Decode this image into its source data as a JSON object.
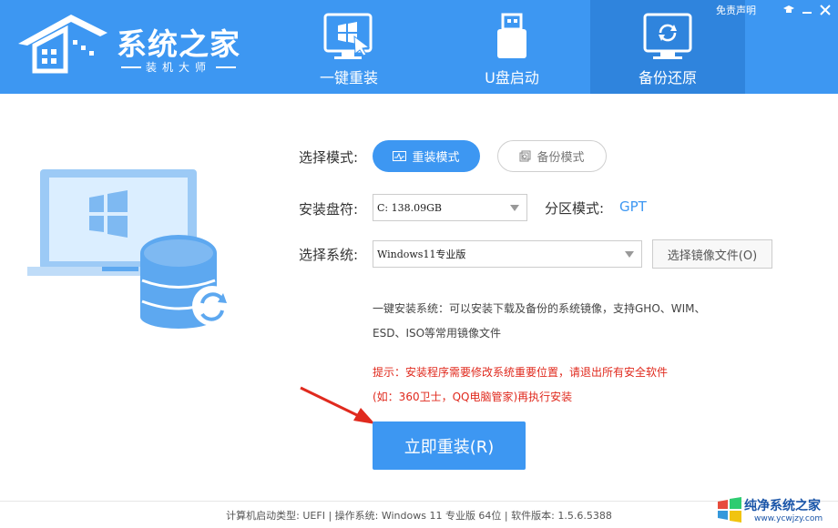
{
  "header": {
    "logo": {
      "title": "系统之家",
      "subtitle": "装机大师"
    },
    "top_links": {
      "disclaimer": "免责声明"
    },
    "tabs": [
      {
        "label": "一键重装",
        "icon": "windows-cursor-icon",
        "active": false
      },
      {
        "label": "U盘启动",
        "icon": "usb-drive-icon",
        "active": false
      },
      {
        "label": "备份还原",
        "icon": "backup-restore-icon",
        "active": true
      }
    ]
  },
  "form": {
    "mode_label": "选择模式:",
    "mode_options": {
      "reinstall": "重装模式",
      "backup": "备份模式"
    },
    "disk_label": "安装盘符:",
    "disk_value": "C: 138.09GB",
    "partition_label": "分区模式:",
    "partition_value": "GPT",
    "system_label": "选择系统:",
    "system_value": "Windows11专业版",
    "image_button": "选择镜像文件(O)"
  },
  "description": {
    "line1": "一键安装系统：可以安装下载及备份的系统镜像，支持GHO、WIM、",
    "line2": "ESD、ISO等常用镜像文件"
  },
  "warning": {
    "line1": "提示：安装程序需要修改系统重要位置，请退出所有安全软件",
    "line2": "(如：360卫士，QQ电脑管家)再执行安装"
  },
  "install_button": "立即重装(R)",
  "footer": {
    "status": "计算机启动类型:  UEFI | 操作系统:  Windows 11 专业版 64位 | 软件版本:  1.5.6.5388"
  },
  "watermark": {
    "title": "纯净系统之家",
    "url": "www.ycwjzy.com"
  },
  "colors": {
    "primary": "#3d97f2",
    "active_tab": "#2f84dd",
    "warning": "#e02a1e"
  }
}
